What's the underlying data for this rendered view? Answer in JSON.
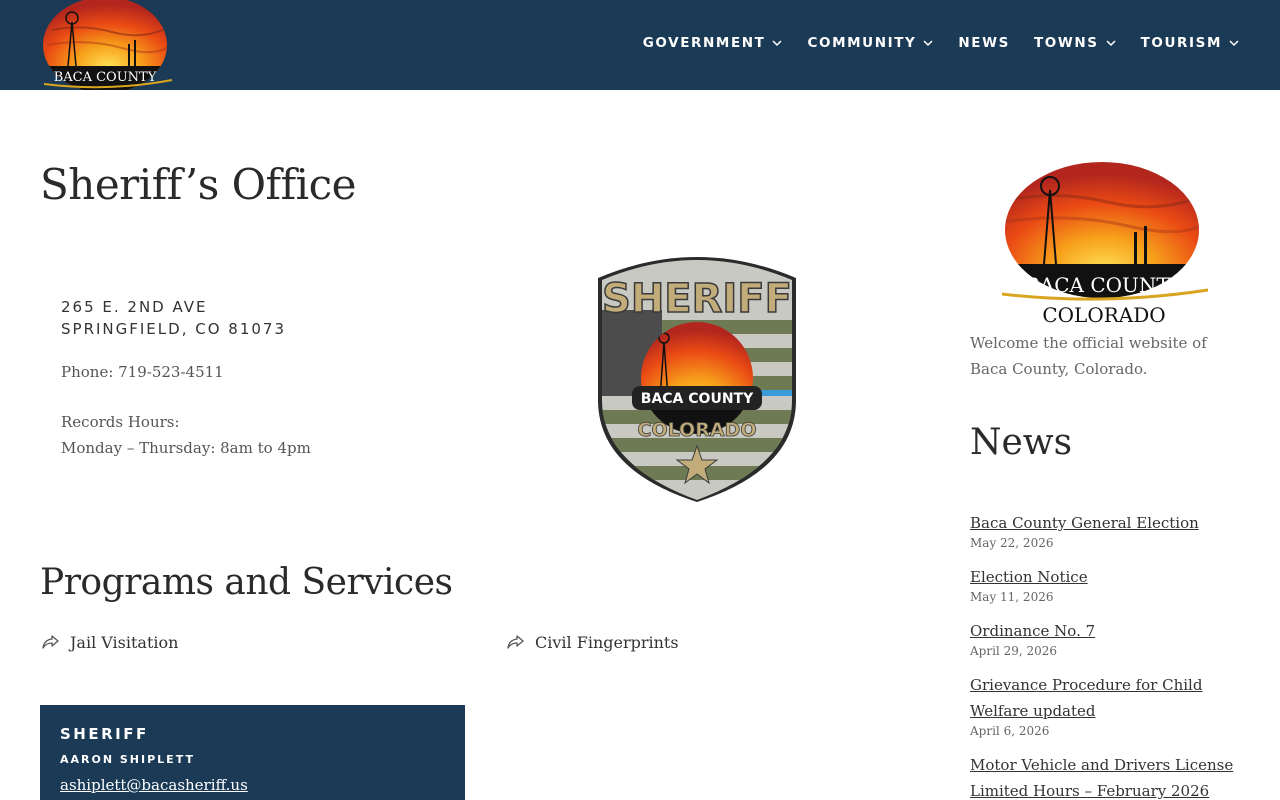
{
  "header": {
    "logo_text": "BACA COUNTY",
    "nav": [
      {
        "label": "GOVERNMENT",
        "has_dropdown": true
      },
      {
        "label": "COMMUNITY",
        "has_dropdown": true
      },
      {
        "label": "NEWS",
        "has_dropdown": false
      },
      {
        "label": "TOWNS",
        "has_dropdown": true
      },
      {
        "label": "TOURISM",
        "has_dropdown": true
      }
    ]
  },
  "main": {
    "title": "Sheriff’s Office",
    "address_line1": "265 E. 2ND AVE",
    "address_line2": "SPRINGFIELD, CO 81073",
    "phone": "Phone: 719-523-4511",
    "hours_label": "Records Hours:",
    "hours_value": "Monday – Thursday: 8am to 4pm",
    "badge": {
      "top": "SHERIFF",
      "middle": "BACA COUNTY",
      "bottom": "COLORADO"
    },
    "programs_title": "Programs and Services",
    "programs": [
      {
        "label": "Jail Visitation"
      },
      {
        "label": "Civil Fingerprints"
      }
    ],
    "sheriff_box": {
      "title": "SHERIFF",
      "name": "AARON SHIPLETT",
      "email": "ashiplett@bacasheriff.us"
    }
  },
  "sidebar": {
    "logo_line1": "BACA COUNTY",
    "logo_line2": "COLORADO",
    "welcome": "Welcome the official website of Baca County, Colorado.",
    "news_title": "News",
    "news": [
      {
        "title": "Baca County General Election",
        "date": "May 22, 2026"
      },
      {
        "title": "Election Notice",
        "date": "May 11, 2026"
      },
      {
        "title": "Ordinance No. 7",
        "date": "April 29, 2026"
      },
      {
        "title": "Grievance Procedure for Child Welfare updated",
        "date": "April 6, 2026"
      },
      {
        "title": "Motor Vehicle and Drivers License Limited Hours – February 2026",
        "date": ""
      }
    ]
  },
  "colors": {
    "header_bg": "#1b3a56",
    "sunset_orange": "#f26a1b",
    "sunset_yellow": "#f7c021"
  }
}
